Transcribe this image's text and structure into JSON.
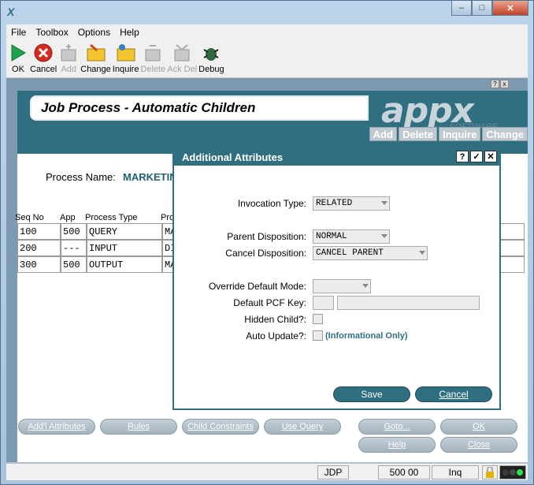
{
  "window": {
    "app_icon": "X"
  },
  "menu": [
    "File",
    "Toolbox",
    "Options",
    "Help"
  ],
  "toolbar": [
    {
      "label": "OK",
      "icon": "play-icon",
      "enabled": true
    },
    {
      "label": "Cancel",
      "icon": "cancel-icon",
      "enabled": true
    },
    {
      "label": "Add",
      "icon": "add-icon",
      "enabled": false
    },
    {
      "label": "Change",
      "icon": "change-folder-icon",
      "enabled": true
    },
    {
      "label": "Inquire",
      "icon": "inquire-folder-icon",
      "enabled": true
    },
    {
      "label": "Delete",
      "icon": "delete-icon",
      "enabled": false
    },
    {
      "label": "Ack Del",
      "icon": "ack-delete-icon",
      "enabled": false
    },
    {
      "label": "Debug",
      "icon": "debug-bug-icon",
      "enabled": true
    }
  ],
  "header": {
    "title": "Job Process - Automatic Children",
    "logo": "appx",
    "logo_sub": "SOFTWARE",
    "mode_buttons": [
      "Add",
      "Delete",
      "Inquire",
      "Change"
    ]
  },
  "process": {
    "label": "Process Name:",
    "value": "MARKETIN"
  },
  "grid": {
    "columns": [
      "Seq No",
      "App",
      "Process Type",
      "Pro"
    ],
    "rows": [
      {
        "seq": "100",
        "app": "500",
        "type": "QUERY",
        "proc": "MA"
      },
      {
        "seq": "200",
        "app": "---",
        "type": "INPUT",
        "proc": "DI"
      },
      {
        "seq": "300",
        "app": "500",
        "type": "OUTPUT",
        "proc": "MA"
      }
    ]
  },
  "bottom_buttons": {
    "addl": "Add'l Attributes",
    "rules": "Rules",
    "child": "Child Constraints",
    "query": "Use Query",
    "goto": "Goto...",
    "ok": "OK",
    "help": "Help",
    "close": "Close"
  },
  "status": {
    "user": "JDP",
    "value": "500 00",
    "mode": "Inq"
  },
  "dialog": {
    "title": "Additional Attributes",
    "fields": {
      "invocation_label": "Invocation Type:",
      "invocation_value": "RELATED",
      "parent_label": "Parent Disposition:",
      "parent_value": "NORMAL",
      "cancel_label": "Cancel Disposition:",
      "cancel_value": "CANCEL PARENT",
      "override_label": "Override Default Mode:",
      "pcf_label": "Default PCF Key:",
      "hidden_label": "Hidden Child?:",
      "auto_label": "Auto Update?:",
      "auto_note": "(Informational Only)"
    },
    "save": "Save",
    "cancel": "Cancel"
  }
}
